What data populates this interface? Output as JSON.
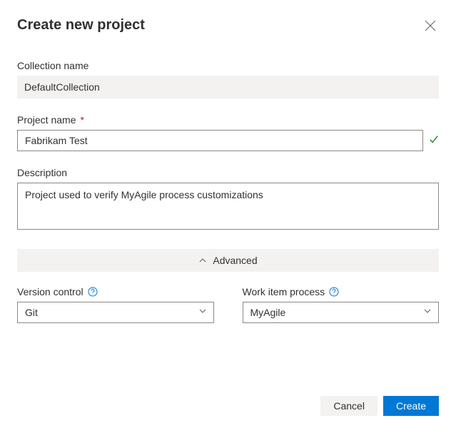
{
  "dialog": {
    "title": "Create new project"
  },
  "fields": {
    "collection_name": {
      "label": "Collection name",
      "value": "DefaultCollection"
    },
    "project_name": {
      "label": "Project name",
      "required_marker": "*",
      "value": "Fabrikam Test"
    },
    "description": {
      "label": "Description",
      "value": "Project used to verify MyAgile process customizations"
    },
    "version_control": {
      "label": "Version control",
      "value": "Git"
    },
    "work_item_process": {
      "label": "Work item process",
      "value": "MyAgile"
    }
  },
  "advanced": {
    "label": "Advanced"
  },
  "actions": {
    "cancel": "Cancel",
    "create": "Create"
  }
}
